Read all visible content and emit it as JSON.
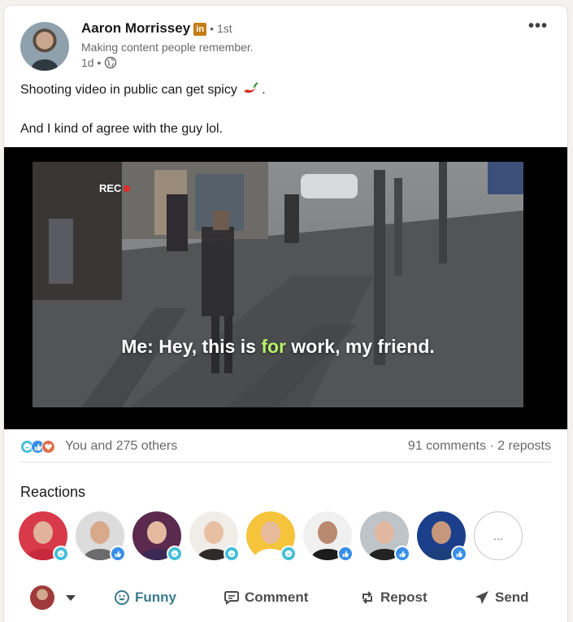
{
  "post": {
    "author_name": "Aaron Morrissey",
    "author_badge": "in",
    "degree": "• 1st",
    "tagline": "Making content people remember.",
    "time": "1d •",
    "text_line1": "Shooting video in public can get spicy",
    "text_line1_end": ".",
    "text_line2": "And I kind of agree with the guy lol.",
    "more_label": "•••"
  },
  "video": {
    "rec_label": "REC",
    "caption_before": "Me: Hey, this is ",
    "caption_highlight": "for",
    "caption_after": " work, my friend.",
    "highlight_color": "#b7f26a"
  },
  "social": {
    "reaction_icon_names": [
      "funny-icon",
      "like-icon",
      "love-icon"
    ],
    "you_and_others": "You and 275 others",
    "counts": "91 comments · 2 reposts"
  },
  "reactions": {
    "title": "Reactions",
    "more_label": "...",
    "people": [
      {
        "reaction": "funny",
        "skin": "#e0b39a",
        "shirt": "#c62a3c",
        "bg": "#d83a4a"
      },
      {
        "reaction": "like",
        "skin": "#d9a98c",
        "shirt": "#6b6b6b",
        "bg": "#dcdcdc"
      },
      {
        "reaction": "funny",
        "skin": "#e5b9a0",
        "shirt": "#3a2a55",
        "bg": "#5b2a4e"
      },
      {
        "reaction": "funny",
        "skin": "#e8bfa3",
        "shirt": "#2e2a2a",
        "bg": "#f0ece8"
      },
      {
        "reaction": "funny",
        "skin": "#e7bb9c",
        "shirt": "#ffffff",
        "bg": "#f5c43b"
      },
      {
        "reaction": "like",
        "skin": "#b98a6f",
        "shirt": "#1c1c1c",
        "bg": "#f0f0f0"
      },
      {
        "reaction": "like",
        "skin": "#e2b7a2",
        "shirt": "#222222",
        "bg": "#bfc4c8"
      },
      {
        "reaction": "like",
        "skin": "#c7977c",
        "shirt": "#1d3f7a",
        "bg": "#1b3f8a"
      }
    ]
  },
  "actions": {
    "funny": "Funny",
    "comment": "Comment",
    "repost": "Repost",
    "send": "Send"
  }
}
